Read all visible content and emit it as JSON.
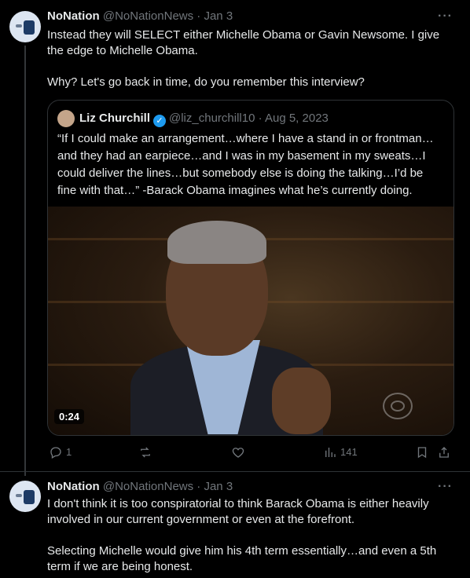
{
  "tweets": [
    {
      "author_name": "NoNation",
      "handle": "@NoNationNews",
      "sep": "·",
      "date": "Jan 3",
      "more": "···",
      "text": "Instead they will SELECT either Michelle Obama or Gavin Newsome.  I give the edge to Michelle Obama.\n\nWhy? Let's go back in time, do you remember this interview?",
      "quote": {
        "author_name": "Liz Churchill",
        "handle": "@liz_churchill10",
        "sep": "·",
        "date": "Aug 5, 2023",
        "text": "“If I could make an arrangement…where I have a stand in or frontman… and they had an earpiece…and I was in my basement in my sweats…I could deliver the lines…but somebody else is doing the talking…I’d be fine with that…” -Barack Obama imagines what he’s currently doing.",
        "video_time": "0:24"
      },
      "actions": {
        "replies": "1",
        "retweets": "",
        "likes": "",
        "views": "141"
      }
    },
    {
      "author_name": "NoNation",
      "handle": "@NoNationNews",
      "sep": "·",
      "date": "Jan 3",
      "more": "···",
      "text": "I don't think it is too conspiratorial to think Barack Obama is either heavily involved in our current government or even at the forefront.\n\nSelecting Michelle would give him his 4th term essentially…and even a 5th term if we are being honest."
    }
  ],
  "colors": {
    "background": "#000000",
    "text": "#e7e9ea",
    "muted": "#71767b",
    "verified": "#1d9bf0",
    "border": "#2f3336"
  }
}
